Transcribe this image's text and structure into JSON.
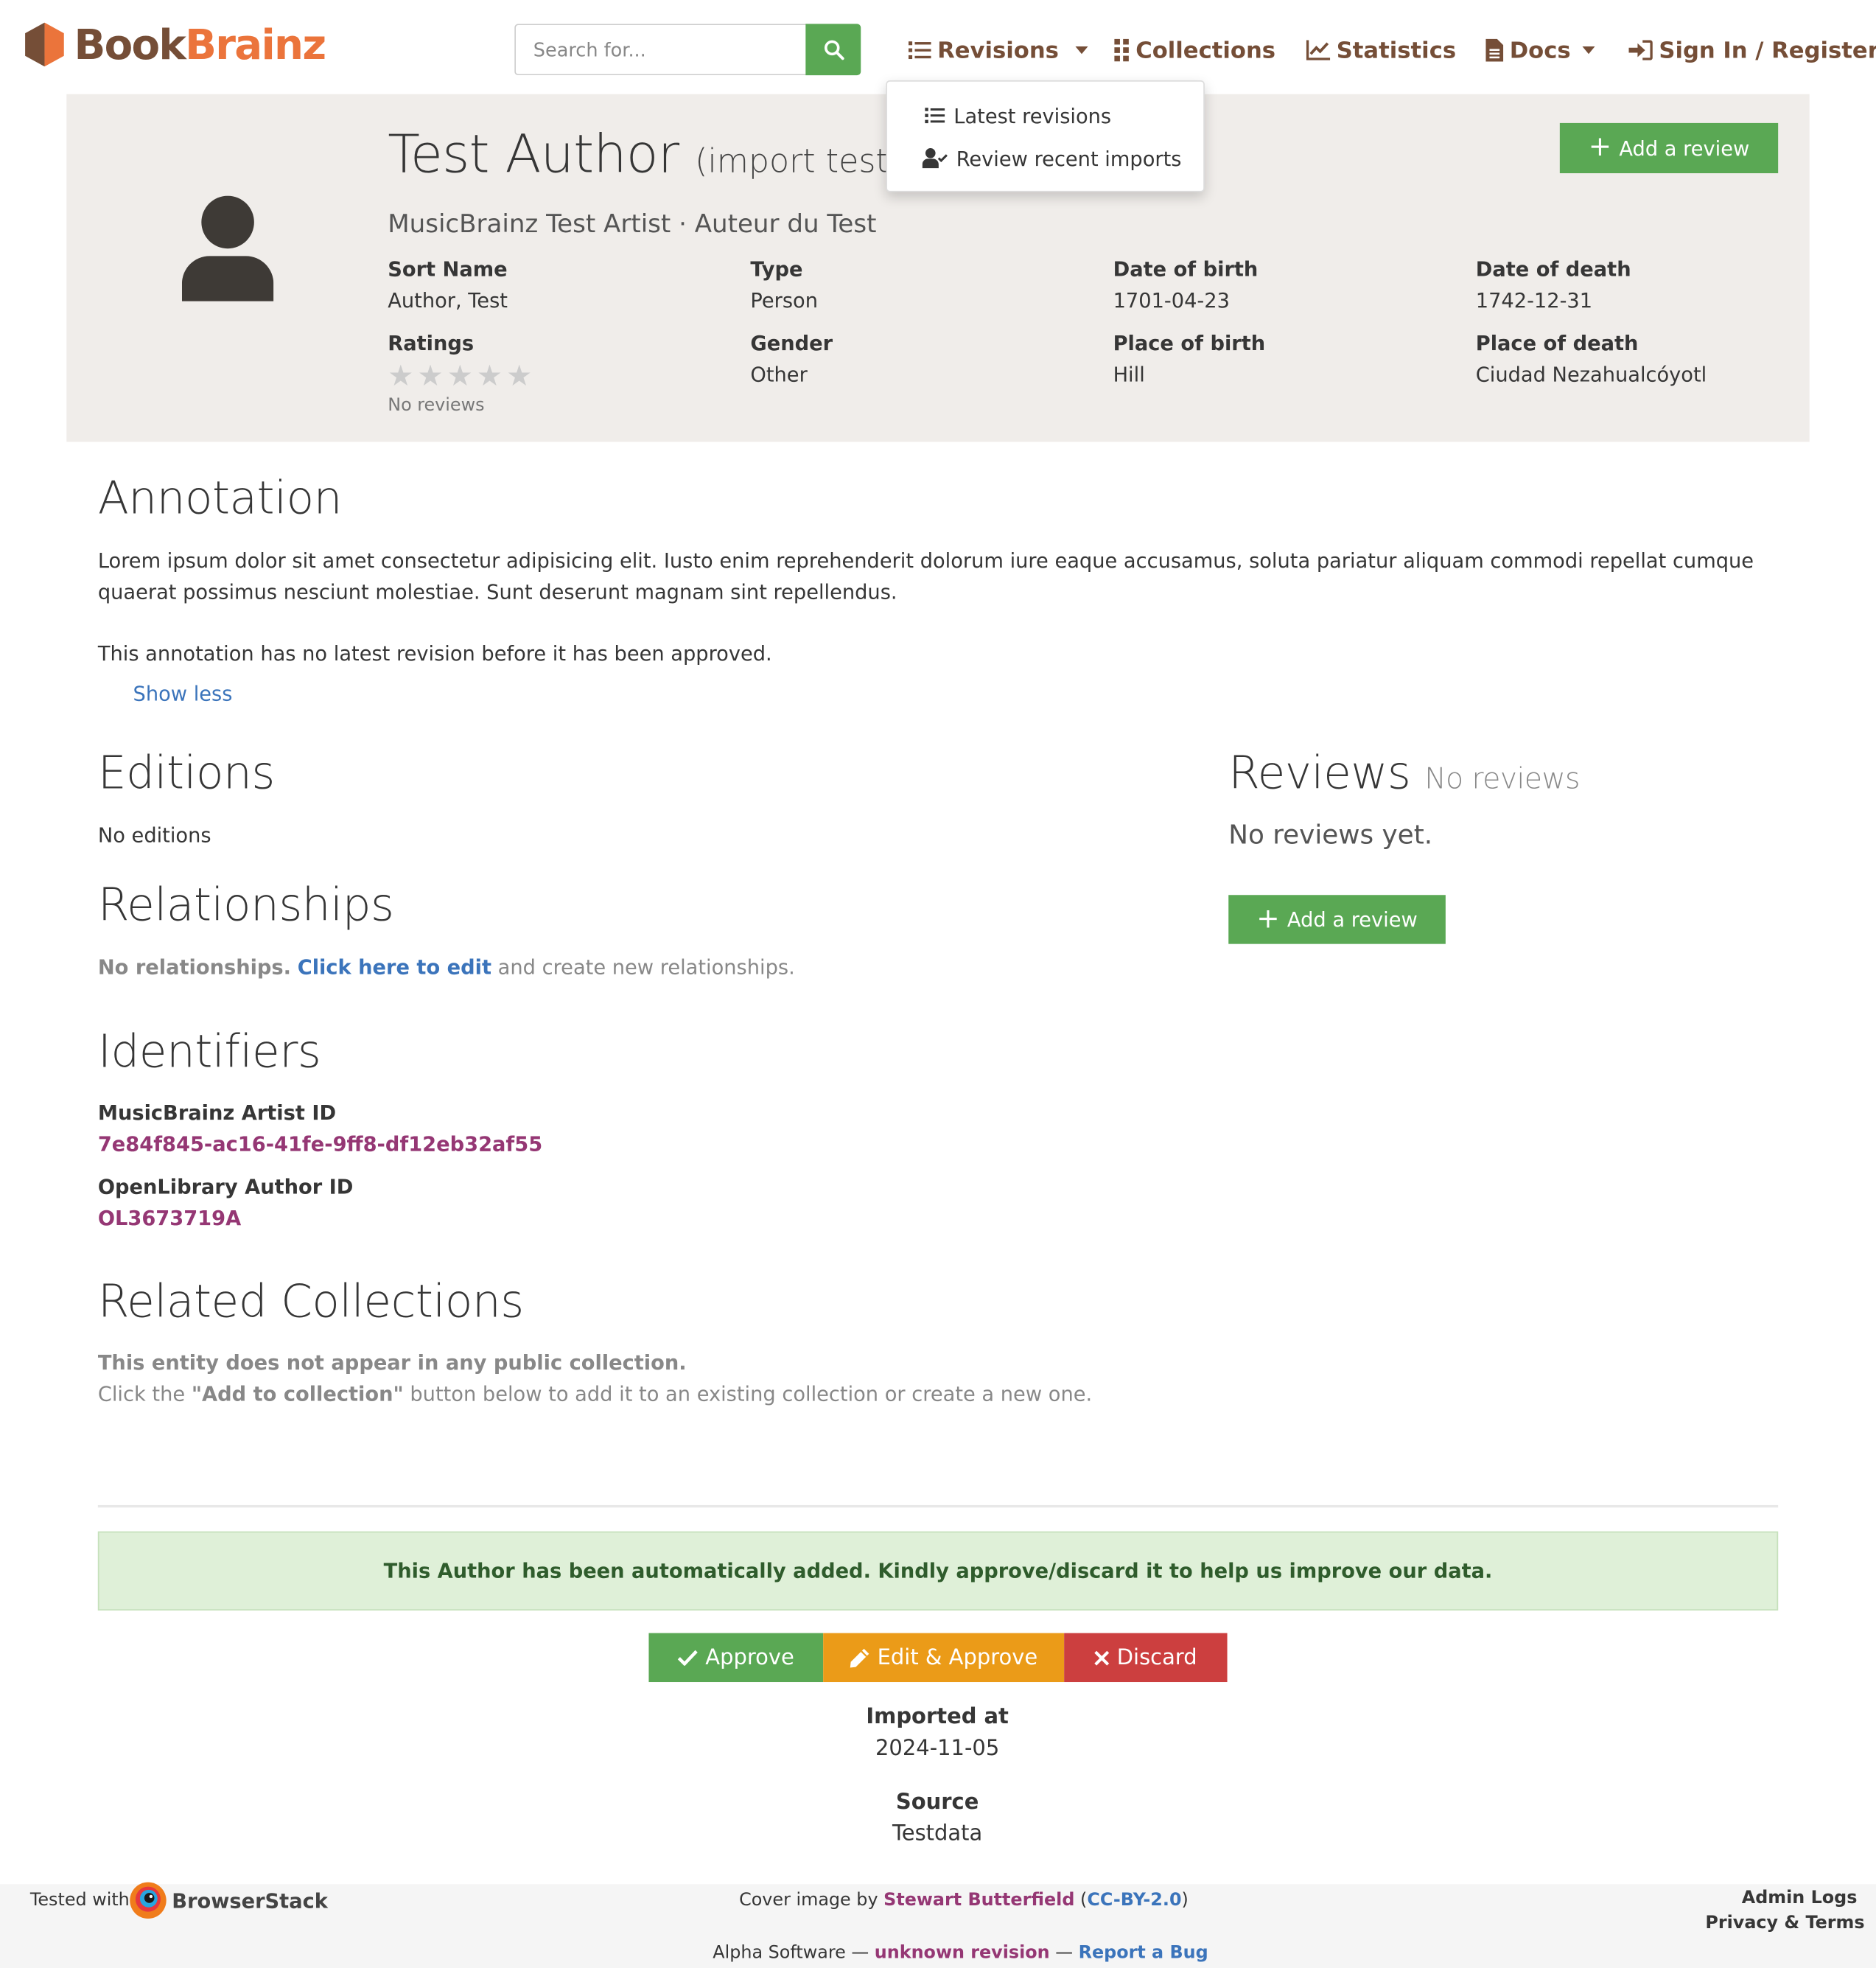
{
  "brand": {
    "part1": "Book",
    "part2": "Brainz",
    "colors": {
      "book": "#754e37",
      "brainz": "#eb743b"
    }
  },
  "search": {
    "placeholder": "Search for..."
  },
  "nav": {
    "revisions": "Revisions",
    "collections": "Collections",
    "statistics": "Statistics",
    "docs": "Docs",
    "sign_in": "Sign In / Register"
  },
  "revisions_menu": {
    "items": [
      "Latest revisions",
      "Review recent imports"
    ]
  },
  "entity": {
    "name": "Test Author",
    "disambiguation": "(import test)",
    "aliases": "MusicBrainz Test Artist · Auteur du Test",
    "add_review": "Add a review",
    "fields": {
      "sort_name": {
        "label": "Sort Name",
        "value": "Author, Test"
      },
      "type": {
        "label": "Type",
        "value": "Person"
      },
      "date_of_birth": {
        "label": "Date of birth",
        "value": "1701-04-23"
      },
      "date_of_death": {
        "label": "Date of death",
        "value": "1742-12-31"
      },
      "ratings": {
        "label": "Ratings",
        "value": "No reviews",
        "stars_filled": 0,
        "stars_total": 5
      },
      "gender": {
        "label": "Gender",
        "value": "Other"
      },
      "place_of_birth": {
        "label": "Place of birth",
        "value": "Hill"
      },
      "place_of_death": {
        "label": "Place of death",
        "value": "Ciudad Nezahualcóyotl"
      }
    }
  },
  "annotation": {
    "heading": "Annotation",
    "text": "Lorem ipsum dolor sit amet consectetur adipisicing elit. Iusto enim reprehenderit dolorum iure eaque accusamus, soluta pariatur aliquam commodi repellat cumque quaerat possimus nesciunt molestiae. Sunt deserunt magnam sint repellendus.",
    "note": "This annotation has no latest revision before it has been approved.",
    "toggle": "Show less"
  },
  "editions": {
    "heading": "Editions",
    "empty": "No editions"
  },
  "relationships": {
    "heading": "Relationships",
    "lead": "No relationships.",
    "link": "Click here to edit",
    "rest": "and create new relationships."
  },
  "identifiers": {
    "heading": "Identifiers",
    "items": [
      {
        "label": "MusicBrainz Artist ID",
        "value": "7e84f845-ac16-41fe-9ff8-df12eb32af55"
      },
      {
        "label": "OpenLibrary Author ID",
        "value": "OL3673719A"
      }
    ]
  },
  "collections": {
    "heading": "Related Collections",
    "lead": "This entity does not appear in any public collection.",
    "text_before": "Click the",
    "text_strong": "\"Add to collection\"",
    "text_after": "button below to add it to an existing collection or create a new one."
  },
  "reviews": {
    "heading": "Reviews",
    "subheading": "No reviews",
    "empty": "No reviews yet.",
    "add_review": "Add a review"
  },
  "import": {
    "alert": "This Author has been automatically added. Kindly approve/discard it to help us improve our data.",
    "approve": "Approve",
    "edit_approve": "Edit & Approve",
    "discard": "Discard",
    "imported_at_label": "Imported at",
    "imported_at": "2024-11-05",
    "source_label": "Source",
    "source": "Testdata",
    "colors": {
      "approve": "#5aa854",
      "edit": "#eb9b18",
      "discard": "#cc3f3f"
    }
  },
  "footer": {
    "tested_with": "Tested with",
    "browserstack": "BrowserStack",
    "cover_prefix": "Cover image by",
    "cover_author": "Stewart Butterfield",
    "cover_license": "CC-BY-2.0",
    "alpha": "Alpha Software —",
    "revision": "unknown revision",
    "dash": "—",
    "report": "Report a Bug",
    "admin_logs": "Admin Logs",
    "privacy": "Privacy & Terms"
  }
}
